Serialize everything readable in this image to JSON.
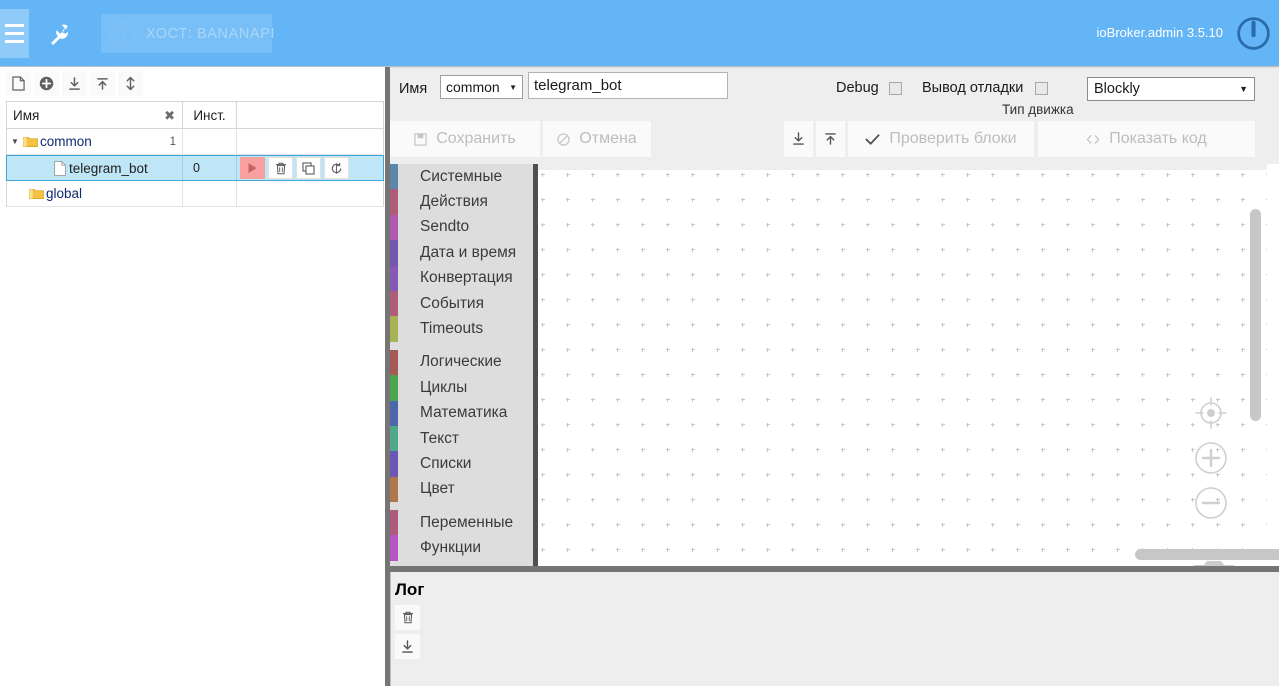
{
  "header": {
    "menu_icon": "hamburger-icon",
    "tools_icon": "wrench-icon",
    "host_icon": "power-circle-icon",
    "host_label": "ХОСТ: BANANAPI",
    "version": "ioBroker.admin 3.5.10",
    "power_icon": "power-icon",
    "accent_color": "#64b5f6"
  },
  "sidebar": {
    "toolbar": [
      {
        "name": "new-script-button",
        "icon": "file-icon"
      },
      {
        "name": "add-button",
        "icon": "plus-circle-icon"
      },
      {
        "name": "export-button",
        "icon": "download-icon"
      },
      {
        "name": "import-button",
        "icon": "upload-icon"
      },
      {
        "name": "expand-collapse-button",
        "icon": "expand-vertical-icon"
      }
    ],
    "columns": {
      "name": "Имя",
      "instance": "Инст.",
      "actions": ""
    },
    "filter_clear_icon": "clear-icon",
    "rows": [
      {
        "type": "folder",
        "label": "common",
        "depth": 0,
        "instance": "",
        "count": "1",
        "expanded": true,
        "selected": false,
        "actions": []
      },
      {
        "type": "script",
        "label": "telegram_bot",
        "depth": 1,
        "instance": "0",
        "count": "",
        "expanded": false,
        "selected": true,
        "actions": [
          {
            "name": "run-script-button",
            "icon": "play-icon",
            "style": "run"
          },
          {
            "name": "delete-script-button",
            "icon": "trash-icon",
            "style": "plain"
          },
          {
            "name": "copy-script-button",
            "icon": "copy-icon",
            "style": "plain"
          },
          {
            "name": "rename-script-button",
            "icon": "rename-icon",
            "style": "plain"
          }
        ]
      },
      {
        "type": "folder",
        "label": "global",
        "depth": 0,
        "instance": "",
        "count": "",
        "expanded": false,
        "selected": false,
        "actions": []
      }
    ]
  },
  "editor": {
    "name_label": "Имя",
    "namespace_value": "common",
    "script_name_value": "telegram_bot",
    "script_name_placeholder": "",
    "debug_label": "Debug",
    "debug_checked": false,
    "debug_output_label": "Вывод отладки",
    "debug_output_checked": false,
    "engine_value": "Blockly",
    "engine_caption": "Тип движка",
    "buttons": {
      "save": {
        "label": "Сохранить",
        "icon": "save-icon",
        "disabled": true
      },
      "cancel": {
        "label": "Отмена",
        "icon": "cancel-icon",
        "disabled": true
      },
      "export": {
        "label": "",
        "icon": "download-icon",
        "disabled": false
      },
      "import": {
        "label": "",
        "icon": "upload-icon",
        "disabled": false
      },
      "check_blocks": {
        "label": "Проверить блоки",
        "icon": "check-icon",
        "disabled": true
      },
      "show_code": {
        "label": "Показать код",
        "icon": "code-icon",
        "disabled": true
      }
    }
  },
  "toolbox": {
    "groups": [
      {
        "categories": [
          {
            "label": "Системные",
            "color": "#5b87ad"
          },
          {
            "label": "Действия",
            "color": "#ad5d78"
          },
          {
            "label": "Sendto",
            "color": "#b05bad"
          },
          {
            "label": "Дата и время",
            "color": "#7158ad"
          },
          {
            "label": "Конвертация",
            "color": "#8659b8"
          },
          {
            "label": "События",
            "color": "#ad5d78"
          },
          {
            "label": "Timeouts",
            "color": "#a8b356"
          }
        ]
      },
      {
        "categories": [
          {
            "label": "Логические",
            "color": "#a55b55"
          },
          {
            "label": "Циклы",
            "color": "#4ca350"
          },
          {
            "label": "Математика",
            "color": "#4f66ad"
          },
          {
            "label": "Текст",
            "color": "#4fa78c"
          },
          {
            "label": "Списки",
            "color": "#6b58b5"
          },
          {
            "label": "Цвет",
            "color": "#b0784a"
          }
        ]
      },
      {
        "categories": [
          {
            "label": "Переменные",
            "color": "#ad5b7d"
          },
          {
            "label": "Функции",
            "color": "#b357c4"
          }
        ]
      }
    ]
  },
  "workspace": {
    "center_icon": "recenter-icon",
    "zoom_in_icon": "zoom-in-icon",
    "zoom_out_icon": "zoom-out-icon",
    "trash_icon": "trash-icon",
    "vertical_scrollbar": "vertical-scrollbar",
    "horizontal_scrollbar": "horizontal-scrollbar"
  },
  "log": {
    "title": "Лог",
    "clear_icon": "trash-icon",
    "export_icon": "download-icon",
    "entries": []
  }
}
